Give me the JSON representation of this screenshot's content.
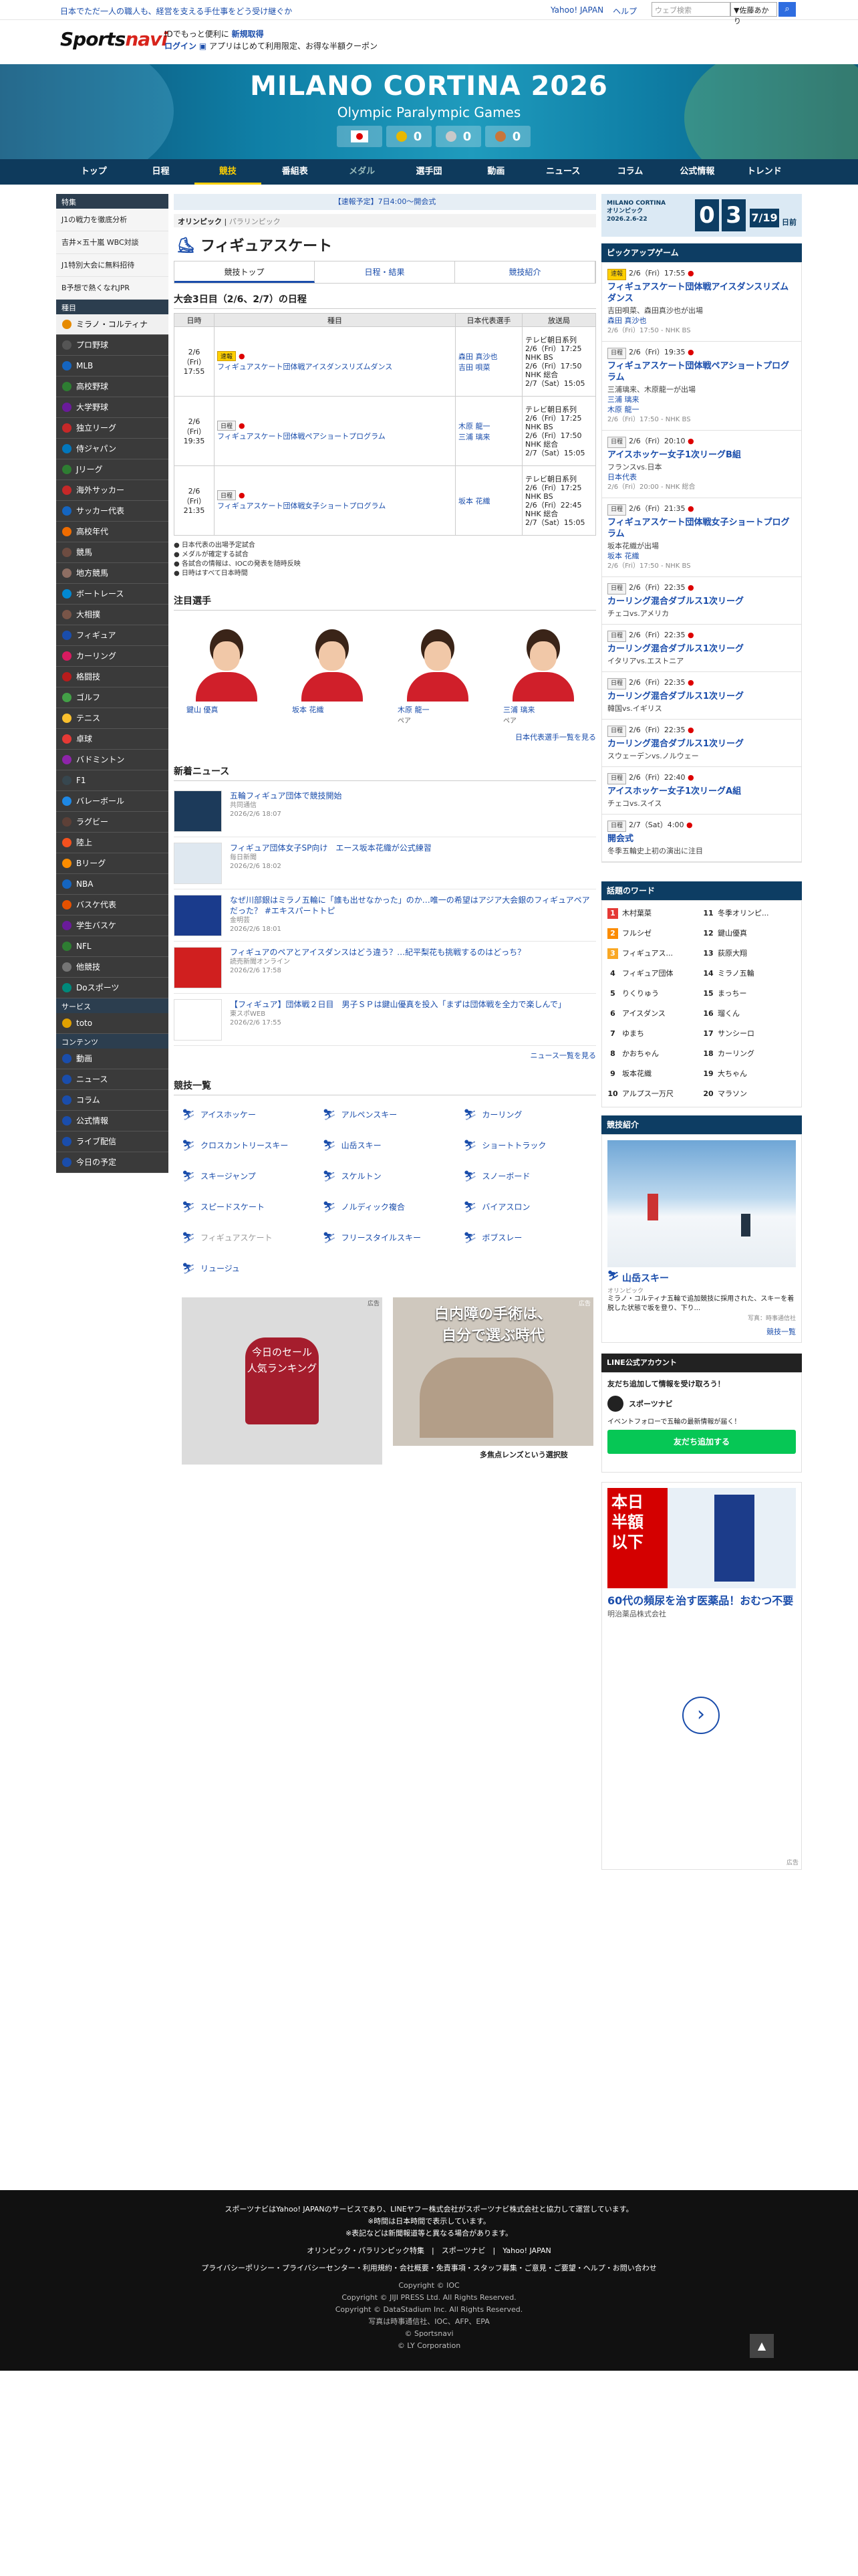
{
  "topbar": {
    "promo": "日本でただ一人の職人も、経営を支える手仕事をどう受け継ぐか",
    "yahoo": "Yahoo! JAPAN",
    "help": "ヘルプ",
    "search_placeholder": "ウェブ検索",
    "search_option": "▼佐藤あかり",
    "search_icon": "search-icon"
  },
  "brand": {
    "logo_a": "Sports",
    "logo_b": "navi",
    "id_line1": "IDでもっと便利に",
    "id_register": "新規取得",
    "id_login": "ログイン",
    "id_line2": "アプリはじめて利用限定、お得な半額クーポン"
  },
  "hero": {
    "title": "MILANO CORTINA 2026",
    "subtitle": "Olympic Paralympic Games",
    "medals": [
      {
        "color": "#e6b800",
        "count": "0"
      },
      {
        "color": "#c9c9c9",
        "count": "0"
      },
      {
        "color": "#c8763a",
        "count": "0"
      }
    ]
  },
  "nav": [
    "トップ",
    "日程",
    "競技",
    "番組表",
    "メダル",
    "選手団",
    "動画",
    "ニュース",
    "コラム",
    "公式情報",
    "トレンド"
  ],
  "sidebar": {
    "features_head": "特集",
    "features": [
      "J1の戦力を徹底分析",
      "吉井×五十嵐 WBC対談",
      "J1特別大会に無料招待",
      "B予想で熱くなれJPR"
    ],
    "sports_head": "種目",
    "sports": [
      "ミラノ・コルティナ",
      "プロ野球",
      "MLB",
      "高校野球",
      "大学野球",
      "独立リーグ",
      "侍ジャパン",
      "Jリーグ",
      "海外サッカー",
      "サッカー代表",
      "高校年代",
      "競馬",
      "地方競馬",
      "ボートレース",
      "大相撲",
      "フィギュア",
      "カーリング",
      "格闘技",
      "ゴルフ",
      "テニス",
      "卓球",
      "バドミントン",
      "F1",
      "バレーボール",
      "ラグビー",
      "陸上",
      "Bリーグ",
      "NBA",
      "バスケ代表",
      "学生バスケ",
      "NFL",
      "他競技",
      "Doスポーツ"
    ],
    "service_head": "サービス",
    "services": [
      "toto"
    ],
    "content_head": "コンテンツ",
    "contents": [
      "動画",
      "ニュース",
      "コラム",
      "公式情報",
      "ライブ配信",
      "今日の予定"
    ]
  },
  "main": {
    "notice": "【速報予定】7日4:00〜開会式",
    "crumb_a": "オリンピック",
    "crumb_b": "パラリンピック",
    "title": "フィギュアスケート",
    "tabs": [
      "競技トップ",
      "日程・結果",
      "競技紹介"
    ],
    "sched_title": "大会3日目（2/6、2/7）の日程",
    "cols": [
      "日時",
      "種目",
      "日本代表選手",
      "放送局"
    ],
    "rows": [
      {
        "date": "2/6（Fri）\n17:55",
        "tag": "速報",
        "event": "フィギュアスケート団体戦アイスダンスリズムダンス",
        "players": "森田 真沙也\n吉田 唄菜",
        "tv": "テレビ朝日系列\n2/6（Fri）17:25\nNHK BS\n2/6（Fri）17:50\nNHK 総合\n2/7（Sat）15:05"
      },
      {
        "date": "2/6（Fri）\n19:35",
        "tag": "日程",
        "event": "フィギュアスケート団体戦ペアショートプログラム",
        "players": "木原 龍一\n三浦 璃来",
        "tv": "テレビ朝日系列\n2/6（Fri）17:25\nNHK BS\n2/6（Fri）17:50\nNHK 総合\n2/7（Sat）15:05"
      },
      {
        "date": "2/6（Fri）\n21:35",
        "tag": "日程",
        "event": "フィギュアスケート団体戦女子ショートプログラム",
        "players": "坂本 花織",
        "tv": "テレビ朝日系列\n2/6（Fri）17:25\nNHK BS\n2/6（Fri）22:45\nNHK 総合\n2/7（Sat）15:05"
      }
    ],
    "legend": [
      "● 日本代表の出場予定試合",
      "● メダルが確定する試合",
      "● 各試合の情報は、IOCの発表を随時反映",
      "● 日時はすべて日本時間"
    ],
    "ath_title": "注目選手",
    "athletes": [
      {
        "name": "鍵山 優真",
        "sub": ""
      },
      {
        "name": "坂本 花織",
        "sub": ""
      },
      {
        "name": "木原 龍一",
        "sub": "ペア"
      },
      {
        "name": "三浦 璃来",
        "sub": "ペア"
      }
    ],
    "ath_more": "日本代表選手一覧を見る",
    "news_title": "新着ニュース",
    "news": [
      {
        "title": "五輪フィギュア団体で競技開始",
        "src": "共同通信",
        "date": "2026/2/6 18:07"
      },
      {
        "title": "フィギュア団体女子SP向け　エース坂本花織が公式練習",
        "src": "毎日新聞",
        "date": "2026/2/6 18:02"
      },
      {
        "title": "なぜ川部銀はミラノ五輪に「誰も出せなかった」のか…唯一の希望はアジア大会銀のフィギュアペアだった？ #エキスパートトピ",
        "src": "金明芸",
        "date": "2026/2/6 18:01"
      },
      {
        "title": "フィギュアのペアとアイスダンスはどう違う？…紀平梨花も挑戦するのはどっち？",
        "src": "読売新聞オンライン",
        "date": "2026/2/6 17:58"
      },
      {
        "title": "【フィギュア】団体戦２日目　男子ＳＰは鍵山優真を投入「まずは団体戦を全力で楽しんで」",
        "src": "東スポWEB",
        "date": "2026/2/6 17:55"
      }
    ],
    "news_more": "ニュース一覧を見る",
    "sports_title": "競技一覧",
    "sportslist": [
      "アイスホッケー",
      "アルペンスキー",
      "カーリング",
      "クロスカントリースキー",
      "山岳スキー",
      "ショートトラック",
      "スキージャンプ",
      "スケルトン",
      "スノーボード",
      "スピードスケート",
      "ノルディック複合",
      "バイアスロン",
      "フィギュアスケート",
      "フリースタイルスキー",
      "ボブスレー",
      "リュージュ"
    ],
    "ad1_text": "今日のセール\n人気ランキング",
    "ad2_text": "白内障の手術は、\n自分で選ぶ時代",
    "ad2_foot": "多焦点レンズという選択肢",
    "ad_label": "広告"
  },
  "right": {
    "cd_brand": "MILANO CORTINA\nオリンピック\n2026.2.6-22",
    "cd_digits": [
      "0",
      "3"
    ],
    "cd_date": "7/19",
    "cd_unit": "日前",
    "pickup_head": "ピックアップゲーム",
    "pickups": [
      {
        "tag": "速報",
        "time": "2/6（Fri）17:55",
        "title": "フィギュアスケート団体戦アイスダンスリズムダンス",
        "sub": "吉田唄菜、森田真沙也が出場",
        "players": "森田 真沙也",
        "bc": "2/6（Fri）17:50 - NHK BS"
      },
      {
        "tag": "日程",
        "time": "2/6（Fri）19:35",
        "title": "フィギュアスケート団体戦ペアショートプログラム",
        "sub": "三浦璃来、木原龍一が出場",
        "players": "三浦 璃来\n木原 龍一",
        "bc": "2/6（Fri）17:50 - NHK BS"
      },
      {
        "tag": "日程",
        "time": "2/6（Fri）20:10",
        "title": "アイスホッケー女子1次リーグB組",
        "sub": "フランスvs.日本",
        "players": "日本代表",
        "bc": "2/6（Fri）20:00 - NHK 総合"
      },
      {
        "tag": "日程",
        "time": "2/6（Fri）21:35",
        "title": "フィギュアスケート団体戦女子ショートプログラム",
        "sub": "坂本花織が出場",
        "players": "坂本 花織",
        "bc": "2/6（Fri）17:50 - NHK BS"
      },
      {
        "tag": "日程",
        "time": "2/6（Fri）22:35",
        "title": "カーリング混合ダブルス1次リーグ",
        "sub": "チェコvs.アメリカ",
        "players": "",
        "bc": ""
      },
      {
        "tag": "日程",
        "time": "2/6（Fri）22:35",
        "title": "カーリング混合ダブルス1次リーグ",
        "sub": "イタリアvs.エストニア",
        "players": "",
        "bc": ""
      },
      {
        "tag": "日程",
        "time": "2/6（Fri）22:35",
        "title": "カーリング混合ダブルス1次リーグ",
        "sub": "韓国vs.イギリス",
        "players": "",
        "bc": ""
      },
      {
        "tag": "日程",
        "time": "2/6（Fri）22:35",
        "title": "カーリング混合ダブルス1次リーグ",
        "sub": "スウェーデンvs.ノルウェー",
        "players": "",
        "bc": ""
      },
      {
        "tag": "日程",
        "time": "2/6（Fri）22:40",
        "title": "アイスホッケー女子1次リーグA組",
        "sub": "チェコvs.スイス",
        "players": "",
        "bc": ""
      },
      {
        "tag": "日程",
        "time": "2/7（Sat）4:00",
        "title": "開会式",
        "sub": "冬季五輪史上初の演出に注目",
        "players": "",
        "bc": ""
      }
    ],
    "rank_head": "話題のワード",
    "ranks": [
      "木村葉菜",
      "フルシゼ",
      "フィギュアス...",
      "フィギュア団体",
      "りくりゅう",
      "アイスダンス",
      "ゆまち",
      "かおちゃん",
      "坂本花織",
      "アルプス一万尺",
      "冬季オリンピ...",
      "鍵山優真",
      "荻原大翔",
      "ミラノ五輪",
      "まっちー",
      "瑠くん",
      "サンシーロ",
      "カーリング",
      "大ちゃん",
      "マラソン"
    ],
    "intro_head": "競技紹介",
    "intro_sport": "山岳スキー",
    "intro_cat": "オリンピック",
    "intro_text": "ミラノ・コルティナ五輪で追加競技に採用された、スキーを着脱した状態で坂を登り、下り...",
    "intro_credit": "写真：時事通信社",
    "intro_more": "競技一覧",
    "line_head": "LINE公式アカウント",
    "line_sub": "友だち追加して情報を受け取ろう！",
    "line_name": "スポーツナビ",
    "line_desc": "イベントフォローで五輪の最新情報が届く！",
    "line_btn": "友だち追加する",
    "ad_title": "60代の頻尿を治す医薬品！おむつ不要",
    "ad_sponsor": "明治薬品株式会社",
    "ad_banner": "本日\n半額\n以下",
    "ad_label": "広告"
  },
  "footer": {
    "line1": "スポーツナビはYahoo! JAPANのサービスであり、LINEヤフー株式会社がスポーツナビ株式会社と協力して運営しています。",
    "line2": "※時間は日本時間で表示しています。",
    "line3": "※表記などは新聞報道等と異なる場合があります。",
    "links1": "オリンピック・パラリンピック特集　|　スポーツナビ　|　Yahoo! JAPAN",
    "links2": "プライバシーポリシー・プライバシーセンター・利用規約・会社概要・免責事項・スタッフ募集・ご意見・ご要望・ヘルプ・お問い合わせ",
    "c1": "Copyright © IOC",
    "c2": "Copyright © JIJI PRESS Ltd. All Rights Reserved.",
    "c3": "Copyright © DataStadium Inc. All Rights Reserved.",
    "c4": "写真は時事通信社、IOC、AFP、EPA",
    "c5": "© Sportsnavi",
    "c6": "© LY Corporation"
  }
}
